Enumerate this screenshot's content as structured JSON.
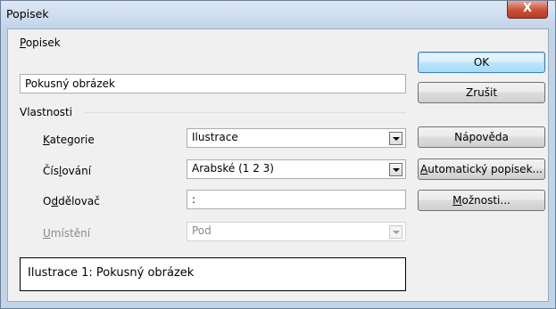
{
  "window": {
    "title": "Popisek",
    "close_symbol": "X"
  },
  "caption": {
    "label": "Popisek",
    "value": "Pokusný obrázek"
  },
  "properties": {
    "heading": "Vlastnosti",
    "category": {
      "label": "Kategorie",
      "value": "Ilustrace"
    },
    "numbering": {
      "label": "Číslování",
      "value": "Arabské (1 2 3)"
    },
    "separator": {
      "label": "Oddělovač",
      "value": ":"
    },
    "position": {
      "label": "Umístění",
      "value": "Pod"
    }
  },
  "preview_text": "Ilustrace 1: Pokusný obrázek",
  "buttons": {
    "ok": "OK",
    "cancel": "Zrušit",
    "help": "Nápověda",
    "auto_caption": "Automatický popisek...",
    "options": "Možnosti..."
  }
}
